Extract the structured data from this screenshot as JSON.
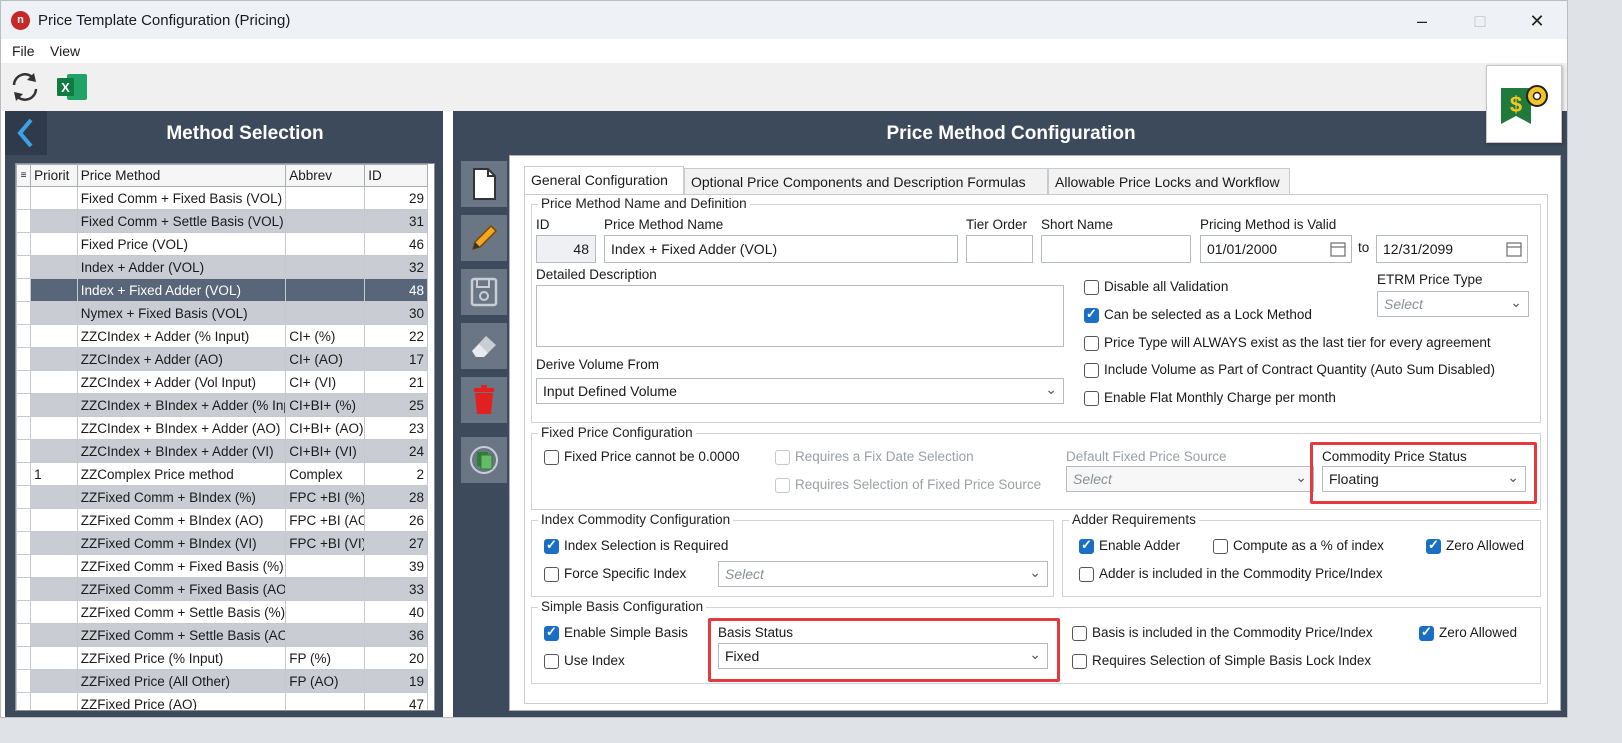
{
  "window": {
    "title": "Price Template Configuration (Pricing)",
    "app_icon": "n"
  },
  "menu": {
    "file": "File",
    "view": "View"
  },
  "left_panel": {
    "title": "Method Selection",
    "columns": [
      "Priorit",
      "Price Method",
      "Abbrev",
      "ID"
    ],
    "rows": [
      {
        "priority": "",
        "method": "Fixed Comm + Fixed Basis (VOL)",
        "abbrev": "",
        "id": "29"
      },
      {
        "priority": "",
        "method": "Fixed Comm + Settle Basis (VOL)",
        "abbrev": "",
        "id": "31"
      },
      {
        "priority": "",
        "method": "Fixed Price (VOL)",
        "abbrev": "",
        "id": "46"
      },
      {
        "priority": "",
        "method": "Index + Adder (VOL)",
        "abbrev": "",
        "id": "32"
      },
      {
        "priority": "",
        "method": "Index + Fixed Adder (VOL)",
        "abbrev": "",
        "id": "48"
      },
      {
        "priority": "",
        "method": "Nymex + Fixed Basis (VOL)",
        "abbrev": "",
        "id": "30"
      },
      {
        "priority": "",
        "method": "ZZCIndex + Adder (% Input)",
        "abbrev": "CI+ (%)",
        "id": "22"
      },
      {
        "priority": "",
        "method": "ZZCIndex + Adder (AO)",
        "abbrev": "CI+ (AO)",
        "id": "17"
      },
      {
        "priority": "",
        "method": "ZZCIndex + Adder (Vol Input)",
        "abbrev": "CI+ (VI)",
        "id": "21"
      },
      {
        "priority": "",
        "method": "ZZCIndex + BIndex + Adder (% Input)",
        "abbrev": "CI+BI+ (%)",
        "id": "25"
      },
      {
        "priority": "",
        "method": "ZZCIndex + BIndex + Adder (AO)",
        "abbrev": "CI+BI+ (AO)",
        "id": "23"
      },
      {
        "priority": "",
        "method": "ZZCIndex + BIndex + Adder (VI)",
        "abbrev": "CI+BI+ (VI)",
        "id": "24"
      },
      {
        "priority": "1",
        "method": "ZZComplex Price method",
        "abbrev": "Complex",
        "id": "2"
      },
      {
        "priority": "",
        "method": "ZZFixed Comm + BIndex (%)",
        "abbrev": "FPC +BI (%)",
        "id": "28"
      },
      {
        "priority": "",
        "method": "ZZFixed Comm + BIndex (AO)",
        "abbrev": "FPC +BI (AO)",
        "id": "26"
      },
      {
        "priority": "",
        "method": "ZZFixed Comm + BIndex (VI)",
        "abbrev": "FPC +BI (VI)",
        "id": "27"
      },
      {
        "priority": "",
        "method": "ZZFixed Comm + Fixed Basis (%)",
        "abbrev": "",
        "id": "39"
      },
      {
        "priority": "",
        "method": "ZZFixed Comm + Fixed Basis (AO)",
        "abbrev": "",
        "id": "33"
      },
      {
        "priority": "",
        "method": "ZZFixed Comm + Settle Basis (%)",
        "abbrev": "",
        "id": "40"
      },
      {
        "priority": "",
        "method": "ZZFixed Comm + Settle Basis (AO)",
        "abbrev": "",
        "id": "36"
      },
      {
        "priority": "",
        "method": "ZZFixed Price (% Input)",
        "abbrev": "FP (%)",
        "id": "20"
      },
      {
        "priority": "",
        "method": "ZZFixed Price (All Other)",
        "abbrev": "FP (AO)",
        "id": "19"
      },
      {
        "priority": "",
        "method": "ZZFixed Price (AO)",
        "abbrev": "",
        "id": "47"
      }
    ],
    "selected_row": 4
  },
  "right_panel": {
    "title": "Price Method Configuration",
    "tabs": [
      "General Configuration",
      "Optional Price Components and Description Formulas",
      "Allowable Price Locks and Workflow"
    ],
    "definition": {
      "group_title": "Price Method Name and Definition",
      "id_label": "ID",
      "id_value": "48",
      "name_label": "Price Method Name",
      "name_value": "Index + Fixed Adder (VOL)",
      "tier_label": "Tier Order",
      "tier_value": "",
      "short_label": "Short Name",
      "short_value": "",
      "valid_label": "Pricing Method is Valid",
      "valid_from": "01/01/2000",
      "to_label": "to",
      "valid_to": "12/31/2099",
      "desc_label": "Detailed Description",
      "desc_value": "",
      "etrm_label": "ETRM Price Type",
      "etrm_placeholder": "Select",
      "derive_label": "Derive Volume From",
      "derive_value": "Input Defined Volume",
      "checks": [
        {
          "label": "Disable all Validation",
          "checked": false
        },
        {
          "label": "Can be selected as a Lock Method",
          "checked": true
        },
        {
          "label": "Price Type will ALWAYS exist as the last tier for every agreement",
          "checked": false
        },
        {
          "label": "Include Volume as Part of Contract Quantity (Auto Sum Disabled)",
          "checked": false
        },
        {
          "label": "Enable Flat Monthly Charge per month",
          "checked": false
        }
      ]
    },
    "fixed_price": {
      "group_title": "Fixed Price Configuration",
      "cannot_zero": "Fixed Price cannot be 0.0000",
      "req_fix_date": "Requires a Fix Date Selection",
      "req_source": "Requires Selection of Fixed Price Source",
      "default_source_label": "Default Fixed Price Source",
      "default_source_placeholder": "Select",
      "commodity_status_label": "Commodity Price Status",
      "commodity_status_value": "Floating"
    },
    "index_commodity": {
      "group_title": "Index Commodity Configuration",
      "index_required": "Index Selection is Required",
      "force_specific": "Force Specific Index",
      "index_placeholder": "Select"
    },
    "adder": {
      "group_title": "Adder Requirements",
      "enable": "Enable Adder",
      "compute_pct": "Compute as a % of index",
      "zero_allowed": "Zero Allowed",
      "included": "Adder is included in the Commodity Price/Index"
    },
    "simple_basis": {
      "group_title": "Simple Basis Configuration",
      "enable": "Enable Simple Basis",
      "use_index": "Use Index",
      "status_label": "Basis Status",
      "status_value": "Fixed",
      "included": "Basis is included in the Commodity Price/Index",
      "zero_allowed": "Zero Allowed",
      "requires_lock": "Requires Selection of Simple Basis Lock Index"
    }
  },
  "colors": {
    "panel": "#3c4a5c",
    "selected_row": "#59667a",
    "alt_row": "#c9cdd3",
    "checkbox_on": "#1a6fc4",
    "highlight": "#e53940"
  }
}
